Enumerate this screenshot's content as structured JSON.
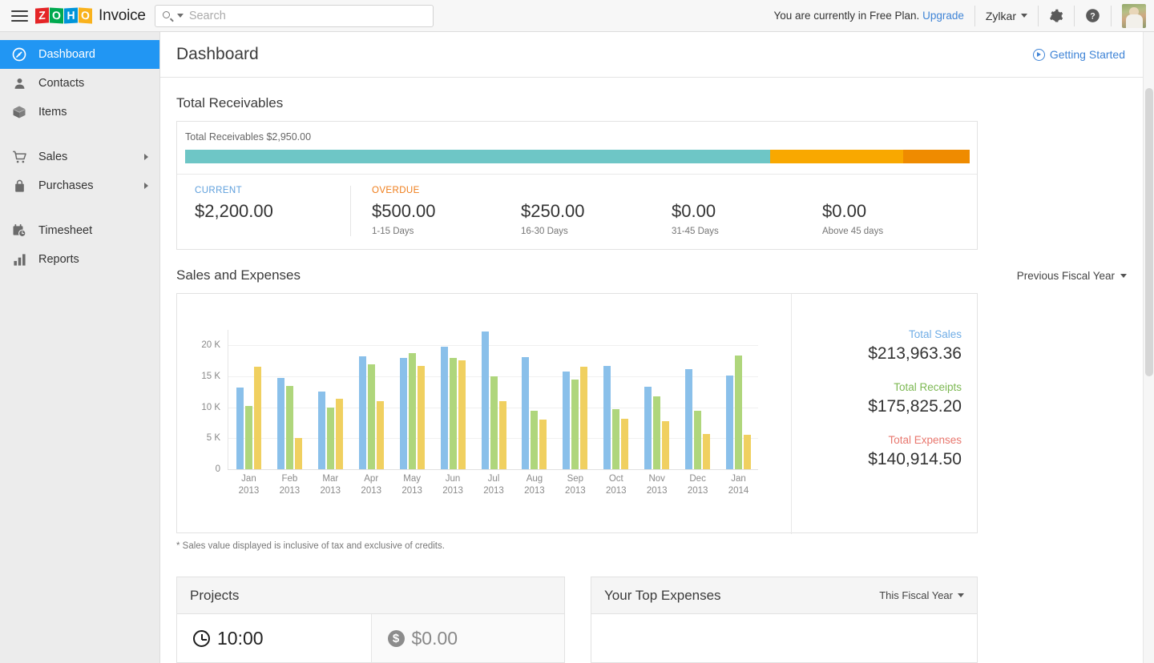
{
  "topbar": {
    "menu_icon": "hamburger-icon",
    "brand_letters": [
      "Z",
      "O",
      "H",
      "O"
    ],
    "brand_name": "Invoice",
    "search": {
      "placeholder": "Search",
      "value": "",
      "icon": "search-icon",
      "dropdown_icon": "chevron-down-icon"
    },
    "plan_notice": "You are currently in Free Plan.",
    "upgrade_label": "Upgrade",
    "org_name": "Zylkar",
    "settings_icon": "gear-icon",
    "help_icon": "help-icon",
    "avatar": "user-avatar"
  },
  "sidebar": {
    "items": [
      {
        "label": "Dashboard",
        "icon": "dashboard-icon",
        "active": true,
        "has_submenu": false
      },
      {
        "label": "Contacts",
        "icon": "contacts-icon",
        "active": false,
        "has_submenu": false
      },
      {
        "label": "Items",
        "icon": "items-box-icon",
        "active": false,
        "has_submenu": false
      },
      {
        "label": "Sales",
        "icon": "cart-icon",
        "active": false,
        "has_submenu": true
      },
      {
        "label": "Purchases",
        "icon": "bag-icon",
        "active": false,
        "has_submenu": true
      },
      {
        "label": "Timesheet",
        "icon": "timesheet-icon",
        "active": false,
        "has_submenu": false
      },
      {
        "label": "Reports",
        "icon": "reports-bar-icon",
        "active": false,
        "has_submenu": false
      }
    ]
  },
  "page": {
    "title": "Dashboard",
    "getting_started": "Getting Started",
    "getting_started_icon": "play-circle-icon"
  },
  "receivables": {
    "section_title": "Total Receivables",
    "summary_label": "Total Receivables $2,950.00",
    "bar_segments": [
      {
        "name": "current",
        "color": "#6ec6c6",
        "percent": 74.6
      },
      {
        "name": "overdue-1-15",
        "color": "#f9a800",
        "percent": 16.9
      },
      {
        "name": "overdue-16-30",
        "color": "#ef8b00",
        "percent": 8.5
      }
    ],
    "current": {
      "caption": "CURRENT",
      "amount": "$2,200.00"
    },
    "overdue_caption": "OVERDUE",
    "overdue": [
      {
        "amount": "$500.00",
        "range": "1-15 Days"
      },
      {
        "amount": "$250.00",
        "range": "16-30 Days"
      },
      {
        "amount": "$0.00",
        "range": "31-45 Days"
      },
      {
        "amount": "$0.00",
        "range": "Above 45 days"
      }
    ]
  },
  "sales_expenses": {
    "section_title": "Sales and Expenses",
    "filter_label": "Previous Fiscal Year",
    "footnote": "* Sales value displayed is inclusive of tax and exclusive of credits.",
    "totals": [
      {
        "label": "Total Sales",
        "value": "$213,963.36",
        "color": "#71aee6",
        "class": "sales"
      },
      {
        "label": "Total Receipts",
        "value": "$175,825.20",
        "color": "#7cb852",
        "class": "receipts"
      },
      {
        "label": "Total Expenses",
        "value": "$140,914.50",
        "color": "#e8776e",
        "class": "expenses"
      }
    ]
  },
  "chart_data": {
    "type": "bar",
    "title": "Sales and Expenses",
    "xlabel": "",
    "ylabel": "",
    "ylim": [
      0,
      22500
    ],
    "yticks": [
      0,
      5000,
      10000,
      15000,
      20000
    ],
    "ytick_labels": [
      "0",
      "5 K",
      "10 K",
      "15 K",
      "20 K"
    ],
    "grid": true,
    "legend_position": "right-panel",
    "categories": [
      "Jan\n2013",
      "Feb\n2013",
      "Mar\n2013",
      "Apr\n2013",
      "May\n2013",
      "Jun\n2013",
      "Jul\n2013",
      "Aug\n2013",
      "Sep\n2013",
      "Oct\n2013",
      "Nov\n2013",
      "Dec\n2013",
      "Jan\n2014"
    ],
    "category_months": [
      "Jan",
      "Feb",
      "Mar",
      "Apr",
      "May",
      "Jun",
      "Jul",
      "Aug",
      "Sep",
      "Oct",
      "Nov",
      "Dec",
      "Jan"
    ],
    "category_years": [
      "2013",
      "2013",
      "2013",
      "2013",
      "2013",
      "2013",
      "2013",
      "2013",
      "2013",
      "2013",
      "2013",
      "2013",
      "2014"
    ],
    "series": [
      {
        "name": "Sales",
        "color": "#8ac0ea",
        "values": [
          13200,
          14800,
          12500,
          18200,
          18000,
          19800,
          22300,
          18100,
          15800,
          16700,
          13300,
          16200,
          15100
        ]
      },
      {
        "name": "Receipts",
        "color": "#afd67c",
        "values": [
          10200,
          13500,
          10000,
          17000,
          18800,
          18000,
          15000,
          9500,
          14500,
          9700,
          11800,
          9500,
          18300
        ]
      },
      {
        "name": "Expenses",
        "color": "#f0d060",
        "values": [
          16500,
          5000,
          11400,
          11000,
          16700,
          17600,
          11000,
          8000,
          16500,
          8100,
          7800,
          5700,
          5500
        ]
      }
    ]
  },
  "projects": {
    "title": "Projects",
    "time_icon": "clock-icon",
    "time_value": "10:00",
    "amount_icon": "dollar-circle-icon",
    "amount_value": "$0.00"
  },
  "top_expenses": {
    "title": "Your Top Expenses",
    "filter_label": "This Fiscal Year"
  }
}
